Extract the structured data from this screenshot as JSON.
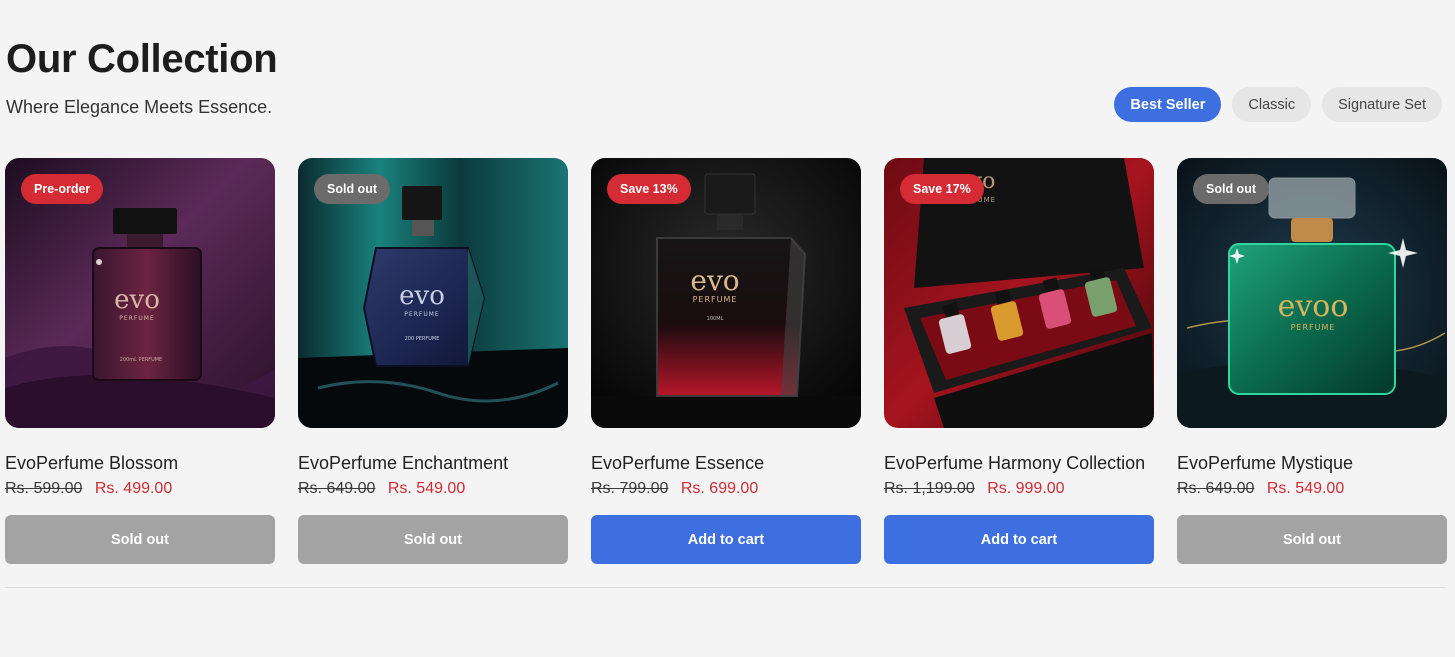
{
  "header": {
    "title": "Our Collection",
    "subtitle": "Where Elegance Meets Essence."
  },
  "filters": [
    {
      "label": "Best Seller",
      "active": true
    },
    {
      "label": "Classic",
      "active": false
    },
    {
      "label": "Signature Set",
      "active": false
    }
  ],
  "products": [
    {
      "name": "EvoPerfume Blossom",
      "old_price": "Rs. 599.00",
      "new_price": "Rs. 499.00",
      "badge": "Pre-order",
      "button": "Sold out",
      "bottle_brand": "evo",
      "bottle_sub": "PERFUME",
      "bottle_note": "200mL PERFUME"
    },
    {
      "name": "EvoPerfume Enchantment",
      "old_price": "Rs. 649.00",
      "new_price": "Rs. 549.00",
      "badge": "Sold out",
      "button": "Sold out",
      "bottle_brand": "evo",
      "bottle_sub": "PERFUME",
      "bottle_note": "200 PERFUME"
    },
    {
      "name": "EvoPerfume Essence",
      "old_price": "Rs. 799.00",
      "new_price": "Rs. 699.00",
      "badge": "Save 13%",
      "button": "Add to cart",
      "bottle_brand": "evo",
      "bottle_sub": "PERFUME",
      "bottle_note": "100ML"
    },
    {
      "name": "EvoPerfume Harmony Collection",
      "old_price": "Rs. 1,199.00",
      "new_price": "Rs. 999.00",
      "badge": "Save 17%",
      "button": "Add to cart",
      "bottle_brand": "evo",
      "bottle_sub": "PERFUME",
      "bottle_note": ""
    },
    {
      "name": "EvoPerfume Mystique",
      "old_price": "Rs. 649.00",
      "new_price": "Rs. 549.00",
      "badge": "Sold out",
      "button": "Sold out",
      "bottle_brand": "evoo",
      "bottle_sub": "PERFUME",
      "bottle_note": ""
    }
  ],
  "colors": {
    "accent": "#3d6fe0",
    "sale_red": "#d02b35",
    "badge_red": "#d42b34",
    "badge_grey": "#6b6b6b",
    "disabled_button": "#a3a3a3",
    "page_bg": "#f4f4f4"
  }
}
